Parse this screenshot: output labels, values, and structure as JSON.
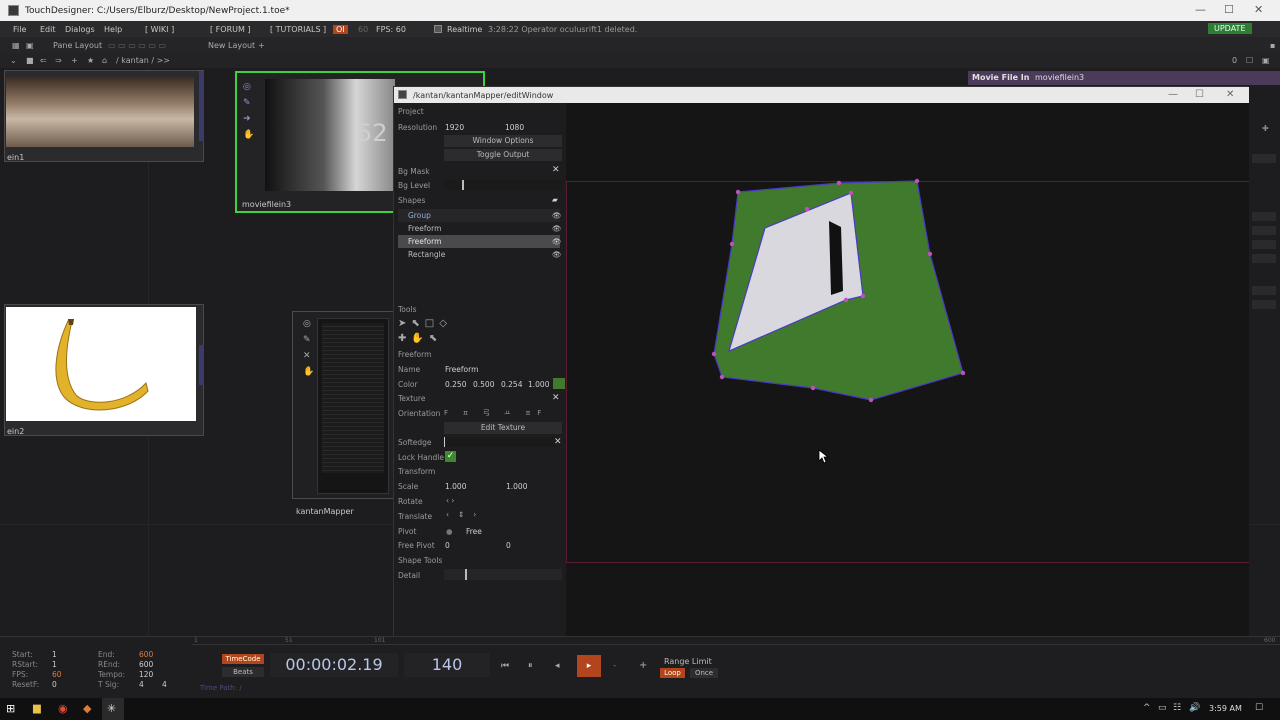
{
  "window": {
    "title": "TouchDesigner: C:/Users/Elburz/Desktop/NewProject.1.toe*"
  },
  "menu": {
    "file": "File",
    "edit": "Edit",
    "dialogs": "Dialogs",
    "help": "Help",
    "wiki": "[ WIKI ]",
    "forum": "[ FORUM ]",
    "tutorials": "[ TUTORIALS ]",
    "oi": "OI",
    "sixty": "60",
    "fps": "FPS: 60",
    "realtime": "Realtime",
    "status": "3:28:22 Operator oculusrift1 deleted.",
    "update": "UPDATE"
  },
  "toolbar": {
    "pane_layout": "Pane Layout",
    "new_layout": "New Layout",
    "path": "/ kantan / >>",
    "zero": "0"
  },
  "nodes": {
    "moviefilein1_label": "ein1",
    "moviefilein2_label": "ein2",
    "moviefilein3_label": "moviefilein3",
    "kantan_label": "kantanMapper",
    "number": "52",
    "moviefilein_param": "Movie File In",
    "moviefilein_param_val": "moviefilein3"
  },
  "editor": {
    "title": "/kantan/kantanMapper/editWindow",
    "project": "Project",
    "resolution_label": "Resolution",
    "res_w": "1920",
    "res_h": "1080",
    "window_options": "Window Options",
    "toggle_output": "Toggle Output",
    "bg_mask": "Bg Mask",
    "bg_level": "Bg Level",
    "shapes": "Shapes",
    "shape_list": [
      "Group",
      "Freeform",
      "Freeform",
      "Rectangle"
    ],
    "tools": "Tools",
    "freeform_header": "Freeform",
    "name_label": "Name",
    "name_value": "Freeform",
    "color_label": "Color",
    "color_values": [
      "0.250",
      "0.500",
      "0.254",
      "1.000"
    ],
    "shape_color": "#3f7a2d",
    "texture": "Texture",
    "orientation": "Orientation",
    "edit_texture": "Edit Texture",
    "softedge": "Softedge",
    "lock_handles": "Lock Handle",
    "transform": "Transform",
    "scale_label": "Scale",
    "scale_x": "1.000",
    "scale_y": "1.000",
    "rotate": "Rotate",
    "translate": "Translate",
    "pivot": "Pivot",
    "pivot_mode": "Free",
    "free_pivot": "Free Pivot",
    "free_pivot_x": "0",
    "free_pivot_y": "0",
    "shape_tools": "Shape Tools",
    "detail": "Detail"
  },
  "timeline": {
    "start_label": "Start:",
    "start": "1",
    "end_label": "End:",
    "end": "600",
    "rstart_label": "RStart:",
    "rstart": "1",
    "rend_label": "REnd:",
    "rend": "600",
    "fps_label": "FPS:",
    "fps": "60",
    "tempo_label": "Tempo:",
    "tempo": "120",
    "resetf_label": "ResetF:",
    "resetf": "0",
    "tsig_label": "T Sig:",
    "tsig_a": "4",
    "tsig_b": "4",
    "timecode_label": "TimeCode",
    "beats_label": "Beats",
    "timecode": "00:00:02.19",
    "frame": "140",
    "range_limit": "Range Limit",
    "loop": "Loop",
    "once": "Once",
    "time_path": "Time Path: /",
    "ruler_1": "1",
    "ruler_51": "51",
    "ruler_101": "101",
    "ruler_600": "600"
  },
  "taskbar": {
    "clock": "3:59 AM"
  }
}
